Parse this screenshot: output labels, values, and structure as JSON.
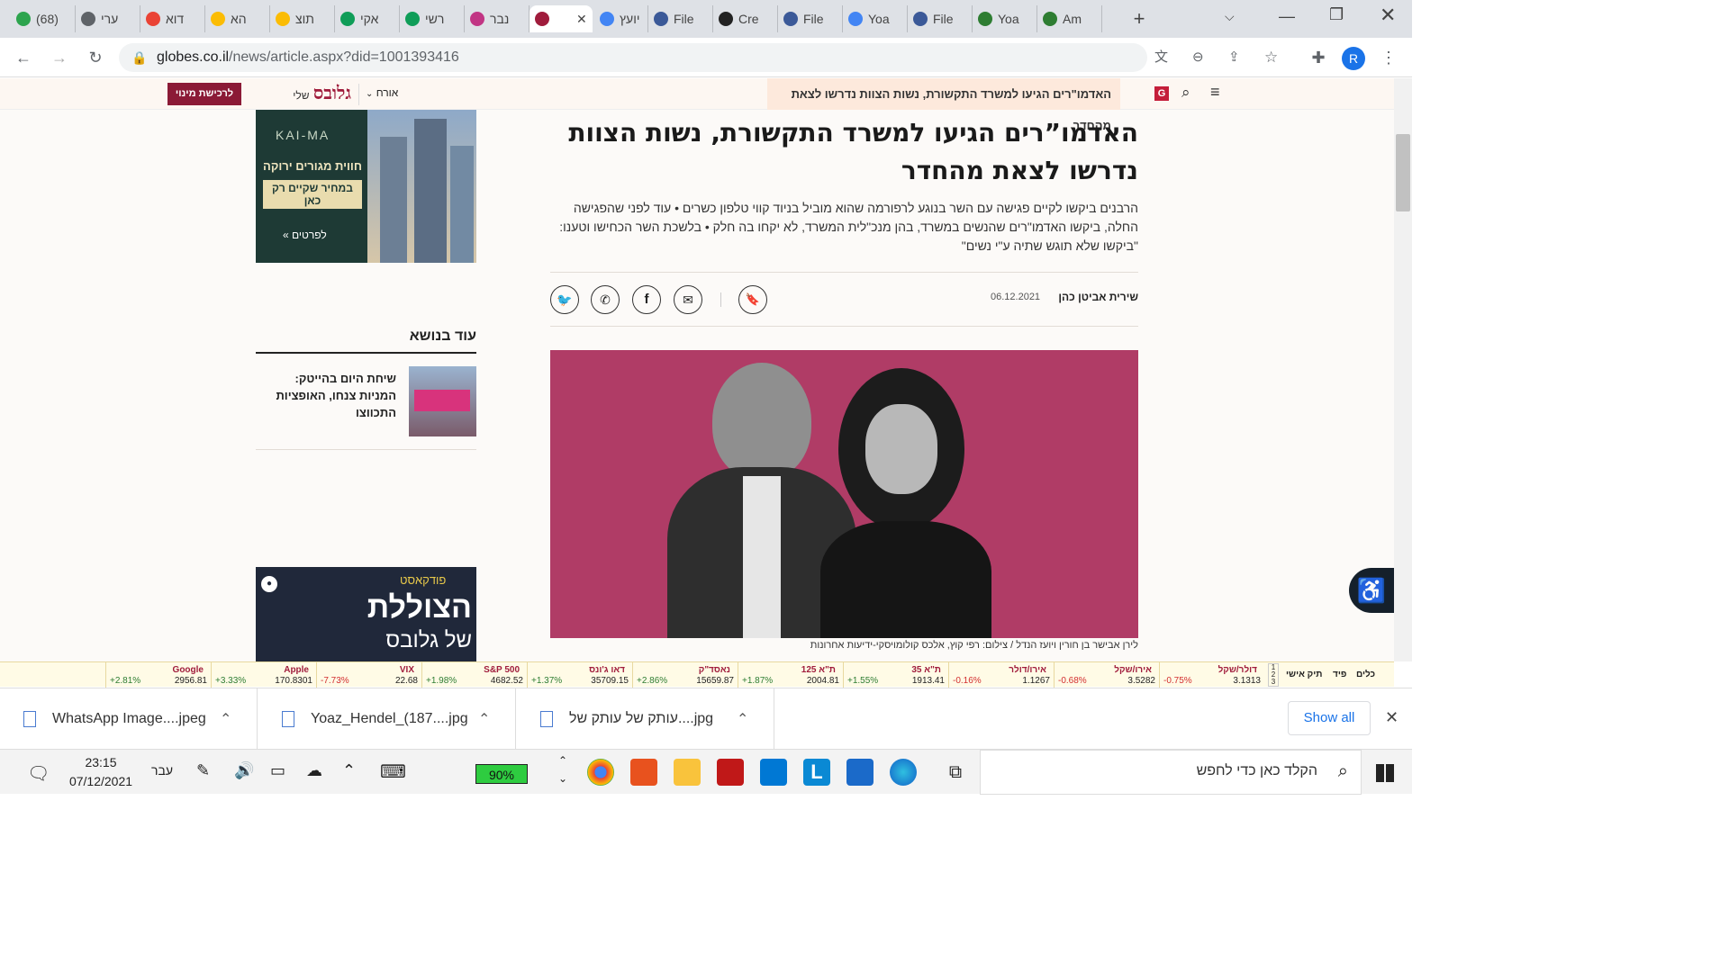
{
  "browser": {
    "tabs": [
      {
        "label": "(68)",
        "color": "#2da44e"
      },
      {
        "label": "ערי",
        "color": "#5f6368"
      },
      {
        "label": "דוא",
        "color": "#ea4335"
      },
      {
        "label": "הא",
        "color": "#fbbc04"
      },
      {
        "label": "תוצ",
        "color": "#fbbc04"
      },
      {
        "label": "אקי",
        "color": "#0f9d58"
      },
      {
        "label": "רשי",
        "color": "#0f9d58"
      },
      {
        "label": "נבר",
        "color": "#c13584"
      },
      {
        "label": "",
        "color": "#a01c3c"
      },
      {
        "label": "יועץ",
        "color": "#4285f4"
      },
      {
        "label": "File",
        "color": "#3b5998"
      },
      {
        "label": "Cre",
        "color": "#222222"
      },
      {
        "label": "File",
        "color": "#3b5998"
      },
      {
        "label": "Yoa",
        "color": "#4285f4"
      },
      {
        "label": "File",
        "color": "#3b5998"
      },
      {
        "label": "Yoa",
        "color": "#2e7d32"
      },
      {
        "label": "Am",
        "color": "#2e7d32"
      }
    ],
    "url_domain": "globes.co.il",
    "url_path": "/news/article.aspx?did=1001393416",
    "profile_initial": "R"
  },
  "site": {
    "breadcrumb_headline": "האדמו\"רים הגיעו למשרד התקשורת, נשות הצוות נדרשו לצאת מהחדר",
    "user_label": "אורח",
    "subscribe_label": "לרכישת מינוי",
    "logo_text": "גלובס",
    "logo_sub": "שלי"
  },
  "article": {
    "title": "האדמו”רים הגיעו למשרד התקשורת, נשות הצוות נדרשו לצאת מהחדר",
    "subtitle": "הרבנים ביקשו לקיים פגישה עם השר בנוגע לרפורמה שהוא מוביל בניוד קווי טלפון כשרים • עוד לפני שהפגישה החלה, ביקשו האדמו\"רים שהנשים במשרד, בהן מנכ\"לית המשרד, לא יקחו בה חלק • בלשכת השר הכחישו וטענו: \"ביקשו שלא תוגש שתיה ע\"י נשים\"",
    "author": "שירית אביטן כהן",
    "date": "06.12.2021",
    "caption": "לירן אבישר בן חורין ויועז הנדל / צילום: רפי קוץ, אלכס קולומויסקי-ידיעות אחרונות"
  },
  "sidebar": {
    "ad1": {
      "brand": "KAI-MA",
      "line1": "חווית מגורים ירוקה",
      "line2": "במחיר שקיים רק כאן",
      "cta": "לפרטים »"
    },
    "related_title": "עוד בנושא",
    "related_item": "שיחת היום בהייטק: המניות צנחו, האופציות התכווצו",
    "ad2": {
      "label": "פודקאסט",
      "big": "הצוללת",
      "sub": "של גלובס"
    }
  },
  "ticker": {
    "controls": [
      "כלים",
      "פיד",
      "תיק אישי"
    ],
    "items": [
      {
        "name": "דולר/שקל",
        "value": "3.1313",
        "change": "-0.75%",
        "color": "#d32f2f"
      },
      {
        "name": "אירו/שקל",
        "value": "3.5282",
        "change": "-0.68%",
        "color": "#d32f2f"
      },
      {
        "name": "אירו/דולר",
        "value": "1.1267",
        "change": "-0.16%",
        "color": "#d32f2f"
      },
      {
        "name": "ת\"א 35",
        "value": "1913.41",
        "change": "+1.55%",
        "color": "#2e7d32"
      },
      {
        "name": "ת\"א 125",
        "value": "2004.81",
        "change": "+1.87%",
        "color": "#2e7d32"
      },
      {
        "name": "נאסד\"ק",
        "value": "15659.87",
        "change": "+2.86%",
        "color": "#2e7d32"
      },
      {
        "name": "דאו ג'ונס",
        "value": "35709.15",
        "change": "+1.37%",
        "color": "#2e7d32"
      },
      {
        "name": "S&P 500",
        "value": "4682.52",
        "change": "+1.98%",
        "color": "#2e7d32"
      },
      {
        "name": "VIX",
        "value": "22.68",
        "change": "-7.73%",
        "color": "#d32f2f"
      },
      {
        "name": "Apple",
        "value": "170.8301",
        "change": "+3.33%",
        "color": "#2e7d32"
      },
      {
        "name": "Google",
        "value": "2956.81",
        "change": "+2.81%",
        "color": "#2e7d32"
      }
    ]
  },
  "downloads": {
    "items": [
      "WhatsApp Image....jpeg",
      "Yoaz_Hendel_(187....jpg",
      "עותק של עותק של....jpg"
    ],
    "show_all": "Show all"
  },
  "taskbar": {
    "search_placeholder": "הקלד כאן כדי לחפש",
    "time": "23:15",
    "date": "07/12/2021",
    "lang": "עבר",
    "battery": "90%"
  }
}
